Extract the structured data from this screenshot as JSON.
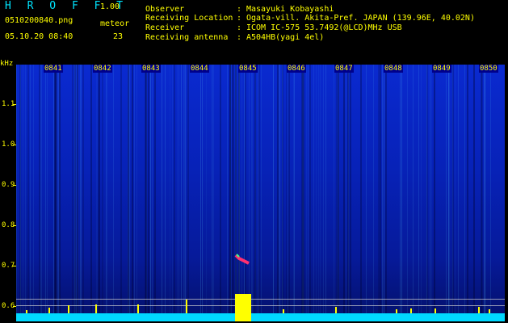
{
  "app": {
    "title": "H R O F F T",
    "version": "1.00"
  },
  "file": {
    "name": "0510200840.png",
    "datetime": "05.10.20 08:40"
  },
  "meteor": {
    "label": "meteor",
    "count": "23"
  },
  "info": [
    {
      "key": "Observer",
      "value": "Masayuki Kobayashi"
    },
    {
      "key": "Receiving Location",
      "value": "Ogata-vill. Akita-Pref. JAPAN (139.96E, 40.02N)"
    },
    {
      "key": "Receiver",
      "value": "ICOM IC-575 53.7492(@LCD)MHz USB"
    },
    {
      "key": "Receiving antenna",
      "value": "A504HB(yagi 4el)"
    }
  ],
  "axis": {
    "unit": "kHz",
    "freq_labels": [
      "1.1",
      "1.0",
      "0.9",
      "0.8",
      "0.7",
      "0.6"
    ],
    "time_labels": [
      "0841",
      "0842",
      "0843",
      "0844",
      "0845",
      "0846",
      "0847",
      "0848",
      "0849",
      "0850"
    ]
  },
  "colors": {
    "label": "#ffff00",
    "background": "#000000",
    "plot": "#0a2ad0",
    "floor": "#00d8ff"
  }
}
